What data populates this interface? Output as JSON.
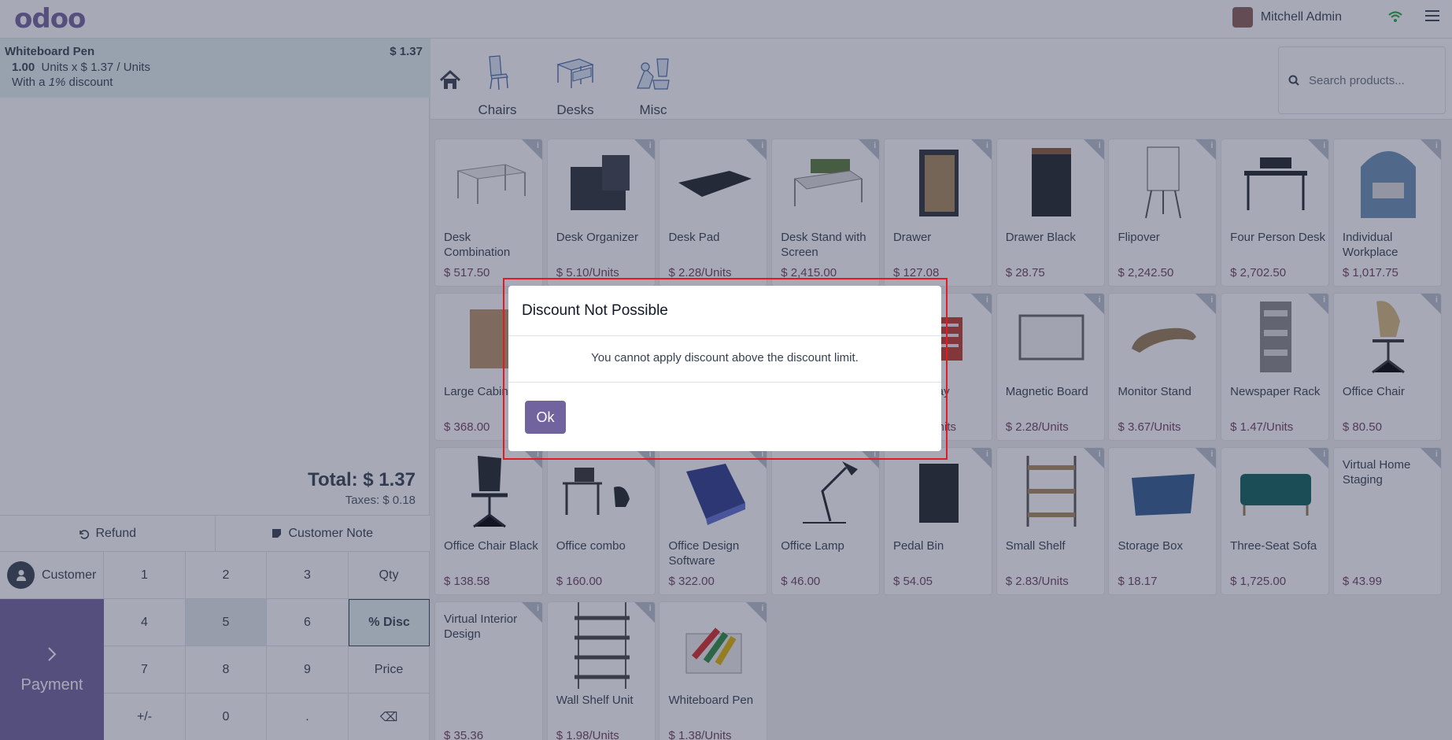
{
  "topbar": {
    "logo": "odoo",
    "user_name": "Mitchell Admin"
  },
  "order": {
    "line_name": "Whiteboard Pen",
    "line_price": "$ 1.37",
    "line_qty": "1.00",
    "line_qty_detail": "Units x $ 1.37 / Units",
    "line_discount_prefix": "With a",
    "line_discount_value": "1%",
    "line_discount_suffix": "discount",
    "total": "Total: $ 1.37",
    "taxes": "Taxes: $ 0.18"
  },
  "actions": {
    "refund": "Refund",
    "customer_note": "Customer Note"
  },
  "numpad": {
    "customer": "Customer",
    "payment": "Payment",
    "keys": [
      "1",
      "2",
      "3",
      "Qty",
      "4",
      "5",
      "6",
      "% Disc",
      "7",
      "8",
      "9",
      "Price",
      "+/-",
      "0",
      ".",
      "⌫"
    ]
  },
  "categories": [
    "Chairs",
    "Desks",
    "Misc"
  ],
  "search": {
    "placeholder": "Search products..."
  },
  "products": [
    {
      "name": "Desk Combination",
      "price": "$ 517.50"
    },
    {
      "name": "Desk Organizer",
      "price": "$ 5.10/Units"
    },
    {
      "name": "Desk Pad",
      "price": "$ 2.28/Units"
    },
    {
      "name": "Desk Stand with Screen",
      "price": "$ 2,415.00"
    },
    {
      "name": "Drawer",
      "price": "$ 127.08"
    },
    {
      "name": "Drawer Black",
      "price": "$ 28.75"
    },
    {
      "name": "Flipover",
      "price": "$ 2,242.50"
    },
    {
      "name": "Four Person Desk",
      "price": "$ 2,702.50"
    },
    {
      "name": "Individual Workplace",
      "price": "$ 1,017.75"
    },
    {
      "name": "Large Cabinet",
      "price": "$ 368.00"
    },
    {
      "name": "",
      "price": ""
    },
    {
      "name": "",
      "price": ""
    },
    {
      "name": "",
      "price": ""
    },
    {
      "name": "Letter Tray",
      "price": "$ 4.34/Units"
    },
    {
      "name": "Magnetic Board",
      "price": "$ 2.28/Units"
    },
    {
      "name": "Monitor Stand",
      "price": "$ 3.67/Units"
    },
    {
      "name": "Newspaper Rack",
      "price": "$ 1.47/Units"
    },
    {
      "name": "Office Chair",
      "price": "$ 80.50"
    },
    {
      "name": "Office Chair Black",
      "price": "$ 138.58"
    },
    {
      "name": "Office combo",
      "price": "$ 160.00"
    },
    {
      "name": "Office Design Software",
      "price": "$ 322.00"
    },
    {
      "name": "Office Lamp",
      "price": "$ 46.00"
    },
    {
      "name": "Pedal Bin",
      "price": "$ 54.05"
    },
    {
      "name": "Small Shelf",
      "price": "$ 2.83/Units"
    },
    {
      "name": "Storage Box",
      "price": "$ 18.17"
    },
    {
      "name": "Three-Seat Sofa",
      "price": "$ 1,725.00"
    },
    {
      "name": "Virtual Home Staging",
      "price": "$ 43.99"
    },
    {
      "name": "Virtual Interior Design",
      "price": "$ 35.36"
    },
    {
      "name": "Wall Shelf Unit",
      "price": "$ 1.98/Units"
    },
    {
      "name": "Whiteboard Pen",
      "price": "$ 1.38/Units"
    }
  ],
  "dialog": {
    "title": "Discount Not Possible",
    "body": "You cannot apply discount above the discount limit.",
    "ok": "Ok"
  },
  "colors": {
    "brand": "#71639e",
    "price": "#6f3e5c",
    "highlight": "#e01b24"
  }
}
